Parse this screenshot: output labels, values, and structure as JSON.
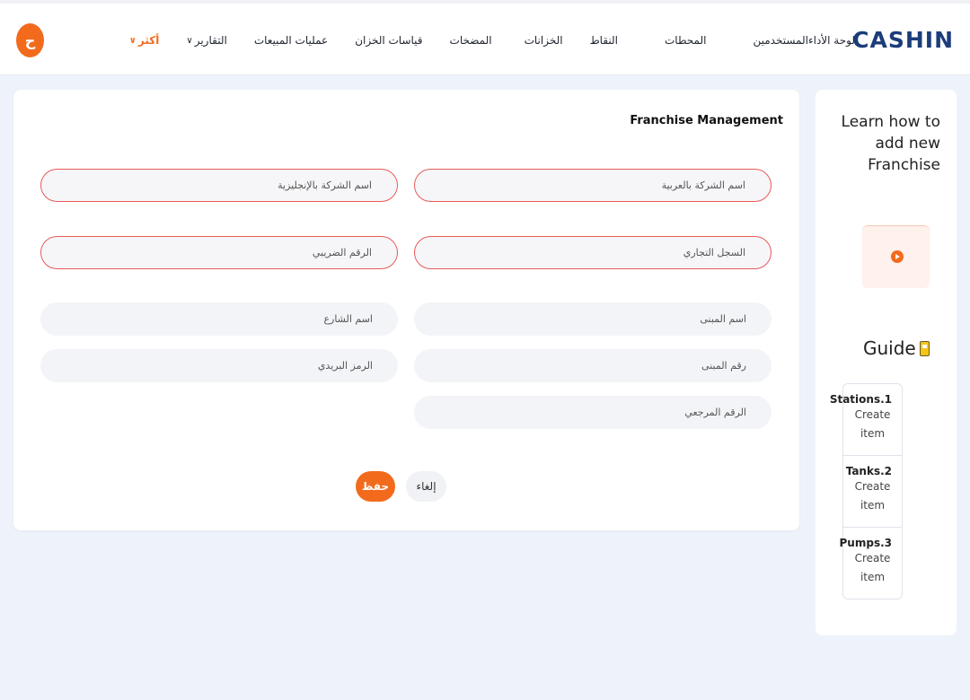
{
  "brand": "CASHIN",
  "nav": {
    "items": [
      "لوحة الأداء",
      "المستخدمين",
      "المحطات",
      "النقاط",
      "الخزانات",
      "المضخات",
      "قياسات الخزان",
      "عمليات المبيعات",
      "التقارير",
      "أكثر"
    ],
    "avatar_initial": "ح"
  },
  "form": {
    "title": "Franchise Management",
    "fields": {
      "company_name_ar": "اسم الشركة بالعربية",
      "company_name_en": "اسم الشركة بالإنجليزية",
      "commercial_register": "السجل التجاري",
      "tax_number": "الرقم الضريبي",
      "building_name": "اسم المبنى",
      "street_name": "اسم الشارع",
      "building_number": "رقم المبنى",
      "postal_code": "الرمز البريدي",
      "reference_number": "الرقم المرجعي"
    },
    "save_label": "حفظ",
    "cancel_label": "إلغاء"
  },
  "sidebar": {
    "title": "Learn how to add new Franchise",
    "guide_label": "Guide",
    "steps": [
      {
        "name": "Stations.1",
        "sub": "Create item"
      },
      {
        "name": "Tanks.2",
        "sub": "Create item"
      },
      {
        "name": "Pumps.3",
        "sub": "Create item"
      }
    ]
  },
  "colors": {
    "accent": "#f26b1d",
    "brand": "#1c3d7a",
    "required_border": "#e85a5a",
    "page_bg": "#eef3fb"
  }
}
